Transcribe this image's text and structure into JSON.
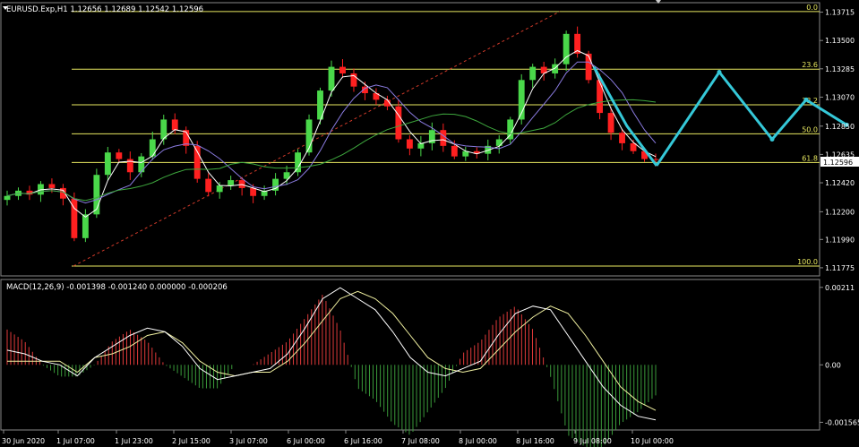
{
  "symbol_header": "EURUSD.Exp,H1  1.12656 1.12689 1.12542 1.12596",
  "macd_header": "MACD(12,26,9) -0.001398 -0.001240 0.000000 -0.000206",
  "current_price": "1.12596",
  "colors": {
    "background": "#000000",
    "bull_candle": "#4ad84a",
    "bear_candle": "#ff2020",
    "fib": "#e8e860",
    "ma_fast": "#ffffff",
    "ma_mid": "#8a7be0",
    "ma_slow": "#3ea83e",
    "projection": "#35c8d8",
    "trendline": "#d03a2a",
    "macd_line": "#ffffff",
    "signal_line": "#f0f0a0",
    "hist_pos": "#e03a3a",
    "hist_neg": "#3a9a3a"
  },
  "chart_data": [
    {
      "type": "line",
      "title": "EURUSD.Exp,H1",
      "price_axis_ticks": [
        "1.13715",
        "1.13500",
        "1.13285",
        "1.13070",
        "1.12850",
        "1.12635",
        "1.12420",
        "1.12200",
        "1.11990",
        "1.11775"
      ],
      "time_axis_ticks": [
        "30 Jun 2020",
        "1 Jul 07:00",
        "1 Jul 23:00",
        "2 Jul 15:00",
        "3 Jul 07:00",
        "6 Jul 00:00",
        "6 Jul 16:00",
        "7 Jul 08:00",
        "8 Jul 00:00",
        "8 Jul 16:00",
        "9 Jul 08:00",
        "10 Jul 00:00"
      ],
      "ylim": [
        1.1172,
        1.1378
      ],
      "fibonacci_levels": [
        {
          "label": "0.0",
          "price": 1.1372
        },
        {
          "label": "23.6",
          "price": 1.13282
        },
        {
          "label": "38.2",
          "price": 1.13012
        },
        {
          "label": "50.0",
          "price": 1.12792
        },
        {
          "label": "61.8",
          "price": 1.12574
        },
        {
          "label": "100.0",
          "price": 1.11788
        }
      ],
      "series": [
        {
          "name": "Close",
          "values": [
            1.1232,
            1.1236,
            1.1233,
            1.1241,
            1.1238,
            1.123,
            1.12,
            1.1218,
            1.1248,
            1.1265,
            1.126,
            1.125,
            1.1262,
            1.1275,
            1.129,
            1.1282,
            1.127,
            1.1245,
            1.1235,
            1.124,
            1.1244,
            1.1238,
            1.1232,
            1.1236,
            1.1245,
            1.125,
            1.1265,
            1.129,
            1.1312,
            1.133,
            1.1325,
            1.1315,
            1.131,
            1.1305,
            1.13,
            1.1275,
            1.1268,
            1.1272,
            1.1282,
            1.127,
            1.1262,
            1.1266,
            1.1264,
            1.127,
            1.1275,
            1.129,
            1.132,
            1.133,
            1.1325,
            1.1332,
            1.1355,
            1.134,
            1.132,
            1.1295,
            1.128,
            1.1272,
            1.1266,
            1.126,
            1.12596
          ]
        }
      ],
      "projection_path": [
        1.1255,
        1.1326,
        1.1275,
        1.1305,
        1.1286
      ],
      "trendline": {
        "from_price": 1.11788,
        "to_price": 1.1372
      }
    },
    {
      "type": "bar",
      "title": "MACD(12,26,9)",
      "y_axis_ticks": [
        "0.00211",
        "0.00",
        "-0.001565"
      ],
      "ylim": [
        -0.00175,
        0.0023
      ],
      "series": [
        {
          "name": "MACD",
          "values": [
            0.0004,
            0.0003,
            0.0001,
            0.0,
            -0.0003,
            0.0002,
            0.0005,
            0.0008,
            0.001,
            0.0009,
            0.0005,
            -0.0001,
            -0.0004,
            -0.0003,
            -0.0002,
            -0.0001,
            0.0003,
            0.001,
            0.0018,
            0.0021,
            0.0018,
            0.0015,
            0.0009,
            0.0002,
            -0.0002,
            -0.0003,
            -0.0001,
            0.0001,
            0.0008,
            0.0014,
            0.0016,
            0.0015,
            0.0008,
            0.0001,
            -0.0006,
            -0.0011,
            -0.0014,
            -0.0015
          ]
        },
        {
          "name": "Signal",
          "values": [
            0.0001,
            0.0001,
            0.0001,
            0.0001,
            -0.0002,
            0.0002,
            0.0003,
            0.0005,
            0.0008,
            0.0009,
            0.0006,
            0.0001,
            -0.0002,
            -0.0003,
            -0.0002,
            -0.0002,
            0.0001,
            0.0006,
            0.0012,
            0.0018,
            0.002,
            0.0018,
            0.0014,
            0.0008,
            0.0002,
            -0.0001,
            -0.0002,
            -0.0001,
            0.0004,
            0.0009,
            0.0013,
            0.0016,
            0.0014,
            0.0008,
            0.0001,
            -0.0006,
            -0.001,
            -0.00124
          ]
        }
      ]
    }
  ]
}
